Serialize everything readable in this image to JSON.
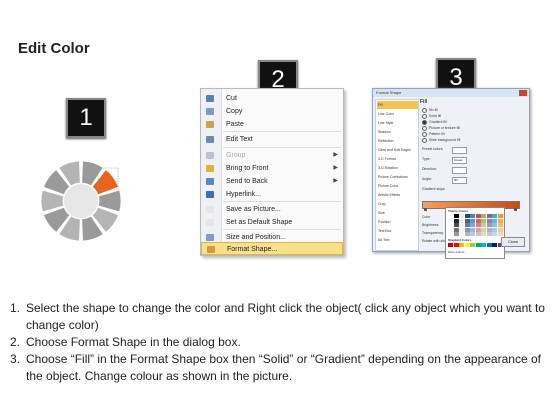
{
  "title": "Edit Color",
  "steps": [
    "1",
    "2",
    "3"
  ],
  "context_menu": {
    "items": [
      {
        "label": "Cut",
        "icon": "scissors-icon",
        "icon_color": "#5a7fb0"
      },
      {
        "label": "Copy",
        "icon": "copy-icon",
        "icon_color": "#7c9bc6"
      },
      {
        "label": "Paste",
        "icon": "paste-icon",
        "icon_color": "#c8a256"
      },
      {
        "label": "Edit Text",
        "icon": "edit-text-icon",
        "icon_color": "#6a88b2"
      },
      {
        "label": "Group",
        "icon": "group-icon",
        "icon_color": "#b9c3d0"
      },
      {
        "label": "Bring to Front",
        "icon": "bring-to-front-icon",
        "icon_color": "#e0b23c"
      },
      {
        "label": "Send to Back",
        "icon": "send-to-back-icon",
        "icon_color": "#5d86c0"
      },
      {
        "label": "Hyperlink...",
        "icon": "hyperlink-icon",
        "icon_color": "#3d6fb0"
      },
      {
        "label": "Save as Picture...",
        "icon": "save-picture-icon",
        "icon_color": "#e6e6e6"
      },
      {
        "label": "Set as Default Shape",
        "icon": "default-shape-icon",
        "icon_color": "#e6e6e6"
      },
      {
        "label": "Size and Position...",
        "icon": "size-position-icon",
        "icon_color": "#7f9cc4"
      },
      {
        "label": "Format Shape...",
        "icon": "format-shape-icon",
        "icon_color": "#d59b3a"
      }
    ]
  },
  "dialog": {
    "title": "Format Shape",
    "sidebar": [
      "Fill",
      "Line Color",
      "Line Style",
      "Shadow",
      "Reflection",
      "Glow and Soft Edges",
      "3-D Format",
      "3-D Rotation",
      "Picture Corrections",
      "Picture Color",
      "Artistic Effects",
      "Crop",
      "Size",
      "Position",
      "Text Box",
      "Alt Text"
    ],
    "pane_heading": "Fill",
    "fill_options": [
      "No fill",
      "Solid fill",
      "Gradient fill",
      "Picture or texture fill",
      "Pattern fill",
      "Slide background fill"
    ],
    "fields": [
      "Preset colors:",
      "Type:",
      "Direction:",
      "Angle:",
      "Gradient stops"
    ],
    "field_values": [
      "",
      "Linear",
      "",
      "90°",
      ""
    ],
    "lower_fields": [
      "Color",
      "Brightness",
      "Transparency",
      "Rotate with shape"
    ],
    "palette": {
      "theme_label": "Theme Colors",
      "standard_label": "Standard Colors",
      "more_label": "More Colors...",
      "theme_row": [
        "#ffffff",
        "#000000",
        "#eeece1",
        "#1f497d",
        "#4f81bd",
        "#c0504d",
        "#9bbb59",
        "#8064a2",
        "#4bacc6",
        "#f79646"
      ],
      "standard_row": [
        "#c00000",
        "#ff0000",
        "#ffc000",
        "#ffff00",
        "#92d050",
        "#00b050",
        "#00b0f0",
        "#0070c0",
        "#002060",
        "#7030a0"
      ]
    },
    "close_label": "Close"
  },
  "instructions": [
    {
      "num": "1.",
      "text": "Select the shape to change the color and Right click the object( click any object which you want to change color)"
    },
    {
      "num": "2.",
      "text": "Choose Format Shape in the dialog box."
    },
    {
      "num": "3.",
      "text": "Choose “Fill” in the Format Shape box then “Solid” or “Gradient” depending on the appearance of the object. Change colour as shown in the picture."
    }
  ],
  "colors": {
    "selected_segment": "#e8641e",
    "ring_gray": "#9a9a9a",
    "highlight": "#fbe08a"
  }
}
